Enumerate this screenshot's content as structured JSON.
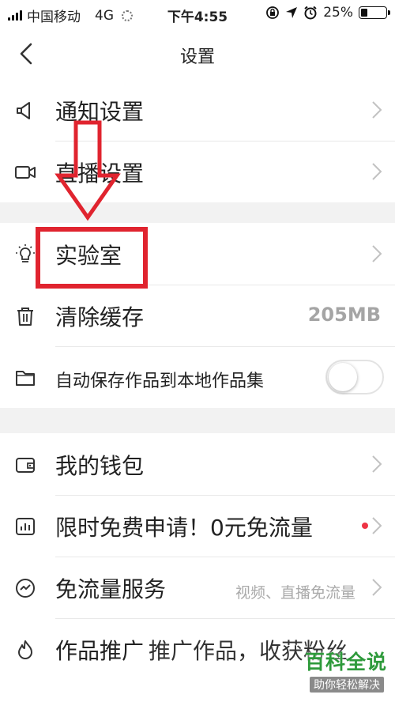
{
  "status_bar": {
    "carrier": "中国移动",
    "network": "4G",
    "time": "下午4:55",
    "battery_text": "25%",
    "battery_level": 0.25
  },
  "nav": {
    "title": "设置",
    "back_icon": "chevron-left-icon"
  },
  "groups": {
    "first": [
      {
        "icon": "megaphone-icon",
        "label": "通知设置"
      },
      {
        "icon": "video-camera-icon",
        "label": "直播设置"
      }
    ],
    "second": [
      {
        "icon": "lightbulb-icon",
        "label": "实验室"
      },
      {
        "icon": "trash-icon",
        "label": "清除缓存",
        "value": "205MB"
      },
      {
        "icon": "folder-icon",
        "label": "自动保存作品到本地作品集",
        "toggle": false
      }
    ],
    "third": [
      {
        "icon": "wallet-icon",
        "label": "我的钱包"
      },
      {
        "icon": "chart-icon",
        "label": "限时免费申请！0元免流量",
        "badge": "red-dot"
      },
      {
        "icon": "trend-icon",
        "label": "免流量服务",
        "sub": "视频、直播免流量"
      },
      {
        "icon": "flame-icon",
        "label": "作品推广",
        "sub": "推广作品，收获粉丝"
      }
    ]
  },
  "annotation_color": "#e0242f",
  "watermark": {
    "title": "百科全说",
    "subtitle": "助你轻松解决"
  }
}
